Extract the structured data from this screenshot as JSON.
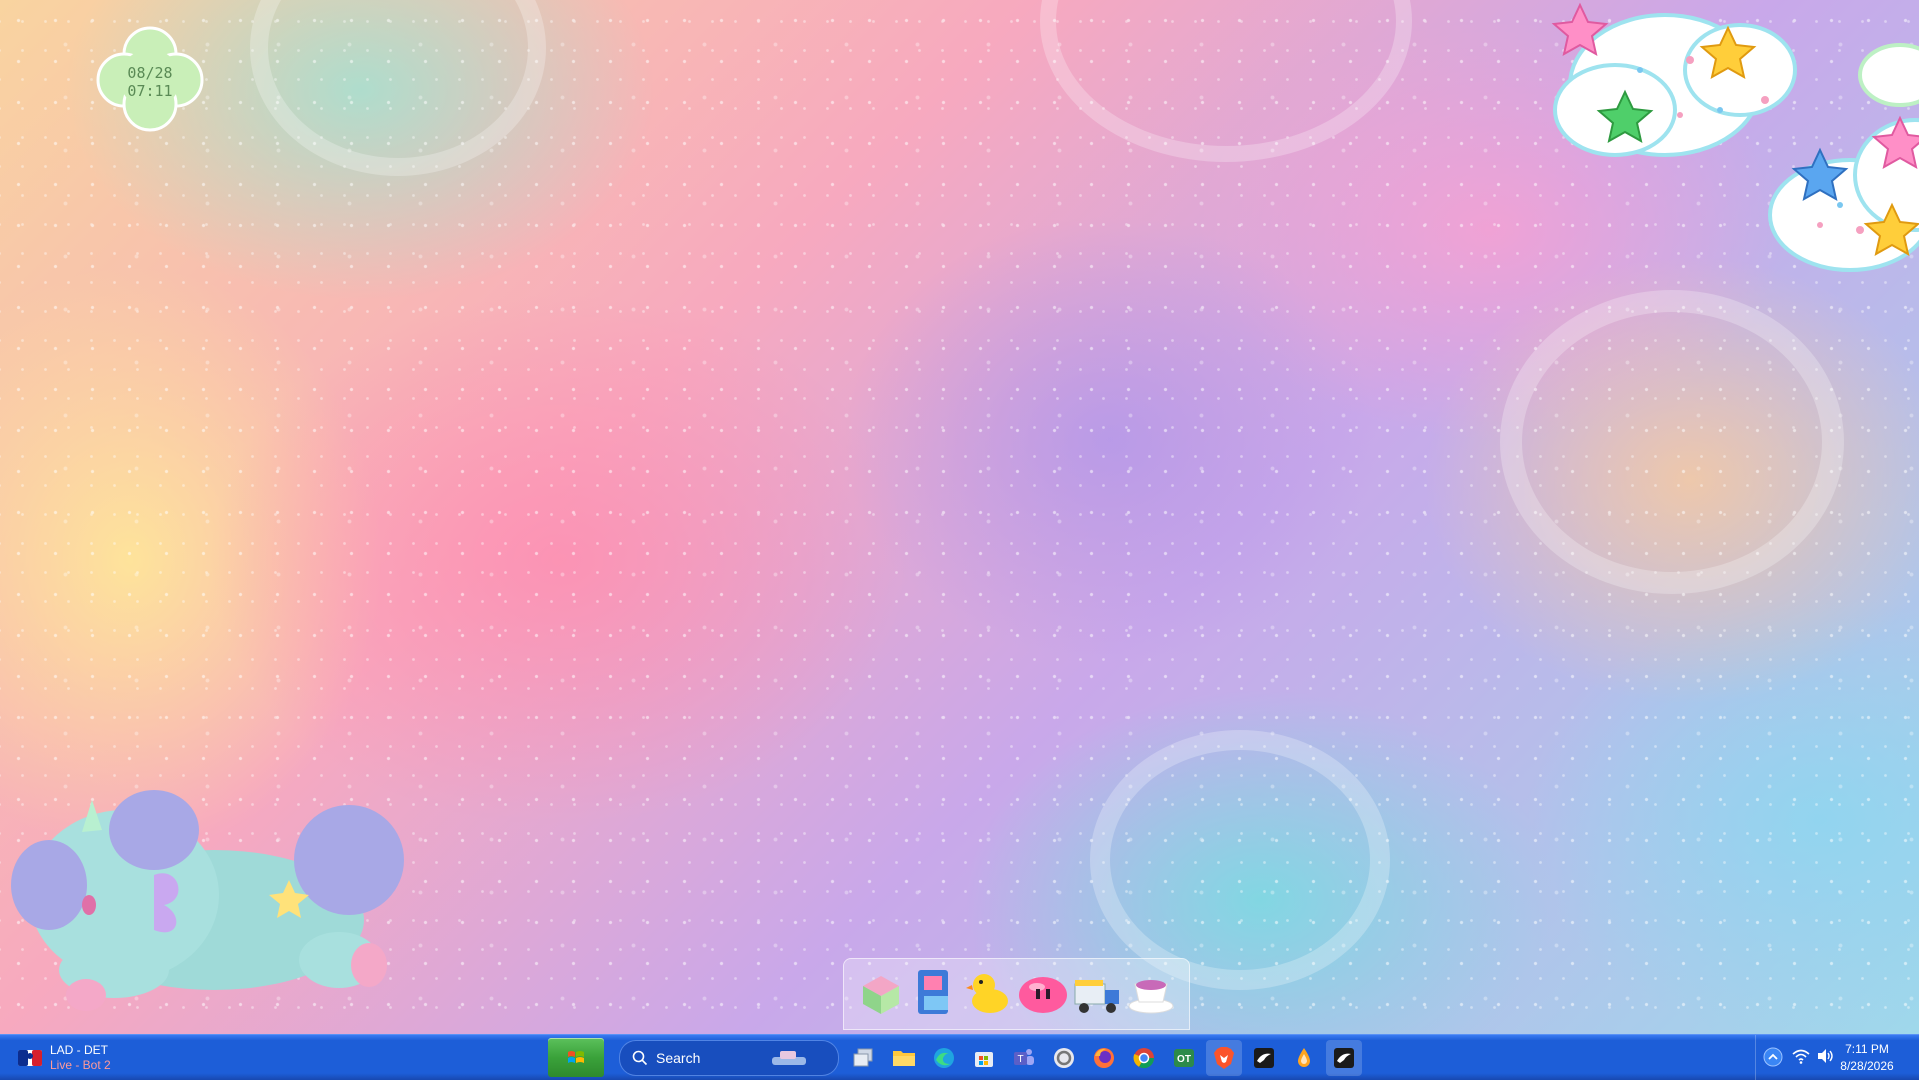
{
  "desktop": {
    "clover_widget": {
      "date": "08/28",
      "time": "07:11"
    }
  },
  "dock": {
    "items": [
      {
        "icon": "gift-box-icon"
      },
      {
        "icon": "cabinet-icon"
      },
      {
        "icon": "rubber-duck-icon"
      },
      {
        "icon": "pink-blob-icon"
      },
      {
        "icon": "truck-icon"
      },
      {
        "icon": "teacup-icon"
      }
    ]
  },
  "taskbar": {
    "widget": {
      "title": "LAD - DET",
      "subtitle": "Live - Bot 2",
      "icon": "mlb-logo-icon"
    },
    "search": {
      "label": "Search"
    },
    "apps": [
      {
        "icon": "task-view-icon"
      },
      {
        "icon": "file-explorer-icon"
      },
      {
        "icon": "edge-icon"
      },
      {
        "icon": "store-icon"
      },
      {
        "icon": "teams-icon"
      },
      {
        "icon": "ring-app-icon"
      },
      {
        "icon": "firefox-icon"
      },
      {
        "icon": "chrome-icon"
      },
      {
        "icon": "ot-app-icon"
      },
      {
        "icon": "brave-icon"
      },
      {
        "icon": "crow-app-icon"
      },
      {
        "icon": "drop-app-icon"
      },
      {
        "icon": "crow-app-active-icon"
      }
    ],
    "tray": {
      "time": "7:11 PM",
      "date": "8/28/2026"
    }
  },
  "colors": {
    "taskbar": "#1d5ed8",
    "start_button": "#3aa23a",
    "clover": "#c9efb8",
    "widget_subtitle": "#ff9a9a"
  }
}
